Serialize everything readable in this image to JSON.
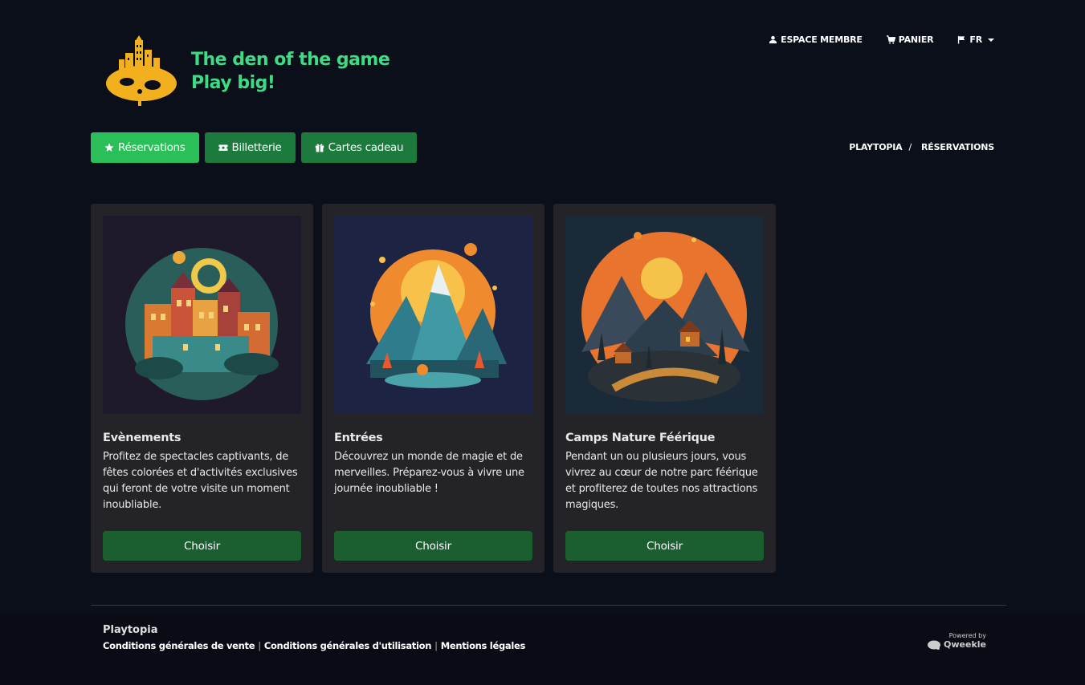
{
  "brand": {
    "tagline_line1": "The den of the game",
    "tagline_line2": "Play big!",
    "logo_icon": "city-gamepad-logo",
    "accent": "#3ddc84"
  },
  "topnav": {
    "member": "ESPACE MEMBRE",
    "cart": "PANIER",
    "lang": "FR"
  },
  "tabs": [
    {
      "label": "Réservations",
      "icon": "star-icon",
      "active": true
    },
    {
      "label": "Billetterie",
      "icon": "ticket-icon",
      "active": false
    },
    {
      "label": "Cartes cadeau",
      "icon": "gift-icon",
      "active": false
    }
  ],
  "breadcrumb": {
    "home": "PLAYTOPIA",
    "separator": "/",
    "current": "RÉSERVATIONS"
  },
  "cards": [
    {
      "title": "Evènements",
      "text": "Profitez de spectacles captivants, de fêtes colorées et d'activités exclusives qui feront de votre visite un moment inoubliable.",
      "button": "Choisir"
    },
    {
      "title": "Entrées",
      "text": "Découvrez un monde de magie et de merveilles. Préparez-vous à vivre une journée inoubliable !",
      "button": "Choisir"
    },
    {
      "title": "Camps Nature Féérique",
      "text": "Pendant un ou plusieurs jours, vous vivrez au cœur de notre parc féérique et profiterez de toutes nos attractions magiques.",
      "button": "Choisir"
    }
  ],
  "footer": {
    "name": "Playtopia",
    "links": [
      "Conditions générales de vente",
      "Conditions générales d'utilisation",
      "Mentions légales"
    ],
    "powered_by": "Powered by",
    "powered_brand": "Qweekle"
  }
}
